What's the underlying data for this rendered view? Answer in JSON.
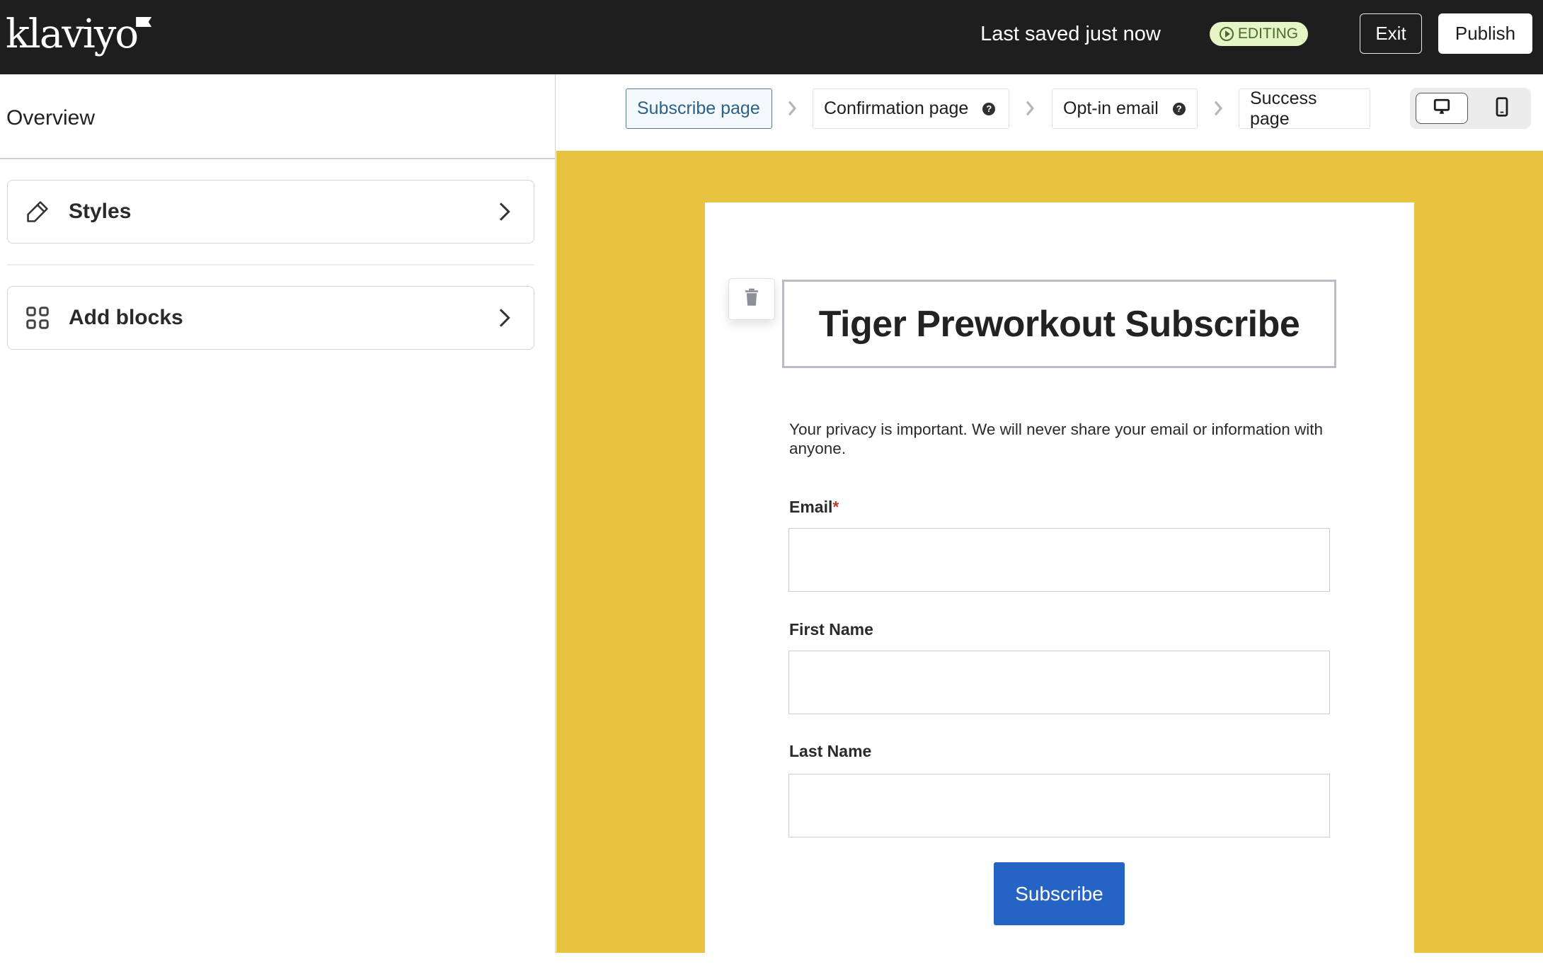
{
  "header": {
    "logo_text": "klaviyo",
    "save_status": "Last saved just now",
    "status_badge": "EDITING",
    "exit_label": "Exit",
    "publish_label": "Publish"
  },
  "sidebar": {
    "title": "Overview",
    "items": [
      {
        "label": "Styles",
        "icon": "pencil-icon"
      },
      {
        "label": "Add blocks",
        "icon": "grid-icon"
      }
    ]
  },
  "steps": [
    {
      "label": "Subscribe page",
      "active": true,
      "help": false
    },
    {
      "label": "Confirmation page",
      "active": false,
      "help": true
    },
    {
      "label": "Opt-in email",
      "active": false,
      "help": true
    },
    {
      "label": "Success page",
      "active": false,
      "help": false
    }
  ],
  "device_toggle": {
    "options": [
      "desktop",
      "mobile"
    ],
    "selected": "desktop"
  },
  "form": {
    "title": "Tiger Preworkout Subscribe",
    "privacy_text": "Your privacy is important. We will never share your email or information with anyone.",
    "fields": [
      {
        "label": "Email",
        "required_marker": "*",
        "value": ""
      },
      {
        "label": "First Name",
        "required_marker": "",
        "value": ""
      },
      {
        "label": "Last Name",
        "required_marker": "",
        "value": ""
      }
    ],
    "submit_label": "Subscribe"
  },
  "colors": {
    "header_bg": "#1e1e1e",
    "canvas_bg": "#e8c33f",
    "submit_bg": "#2563c4",
    "badge_bg": "#e6f5c8",
    "active_step": "#2e6189",
    "required": "#c0392b"
  }
}
